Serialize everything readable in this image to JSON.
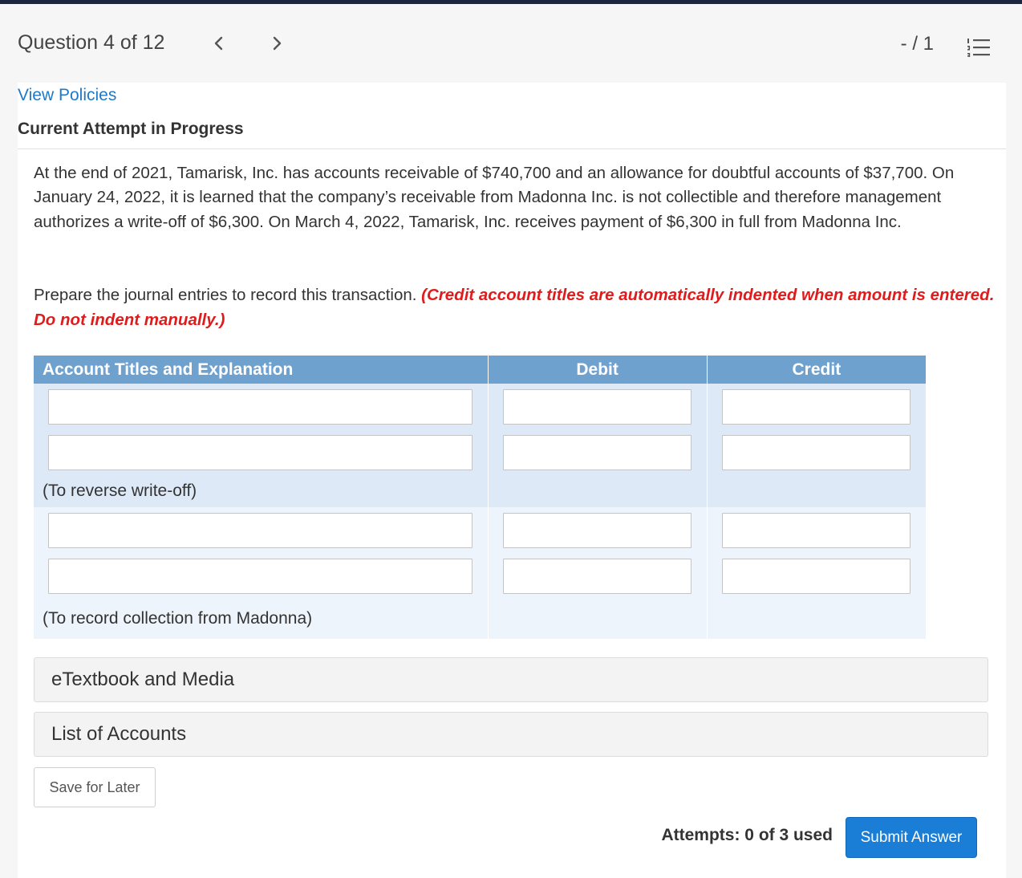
{
  "header": {
    "question_counter": "Question 4 of 12",
    "score": "- / 1",
    "prev_icon": "chevron-left-icon",
    "next_icon": "chevron-right-icon",
    "menu_icon": "numbered-list-icon"
  },
  "links": {
    "view_policies": "View Policies"
  },
  "attempt_title": "Current Attempt in Progress",
  "problem": {
    "text": "At the end of 2021, Tamarisk, Inc. has accounts receivable of $740,700 and an allowance for doubtful accounts of $37,700. On January 24, 2022, it is learned that the company’s receivable from Madonna Inc. is not collectible and therefore management authorizes a write-off of $6,300. On March 4, 2022, Tamarisk, Inc. receives payment of $6,300 in full from Madonna Inc.",
    "instruction": "Prepare the journal entries to record this transaction.",
    "note": "(Credit account titles are automatically indented when amount is entered. Do not indent manually.)"
  },
  "journal": {
    "columns": [
      "Account Titles and Explanation",
      "Debit",
      "Credit"
    ],
    "groups": [
      {
        "rows": [
          {
            "account": "",
            "debit": "",
            "credit": ""
          },
          {
            "account": "",
            "debit": "",
            "credit": ""
          }
        ],
        "label": "(To reverse write-off)"
      },
      {
        "rows": [
          {
            "account": "",
            "debit": "",
            "credit": ""
          },
          {
            "account": "",
            "debit": "",
            "credit": ""
          }
        ],
        "label": "(To record collection from Madonna)"
      }
    ]
  },
  "accordions": {
    "etextbook": "eTextbook and Media",
    "list_of_accounts": "List of Accounts"
  },
  "buttons": {
    "save_for_later": "Save for Later",
    "submit": "Submit Answer"
  },
  "attempts": "Attempts: 0 of 3 used",
  "colors": {
    "header_stripe": "#1c2540",
    "link": "#1f78c8",
    "note_red": "#e01b1b",
    "table_header": "#6fa1cf",
    "submit_blue": "#1a7dd6"
  }
}
